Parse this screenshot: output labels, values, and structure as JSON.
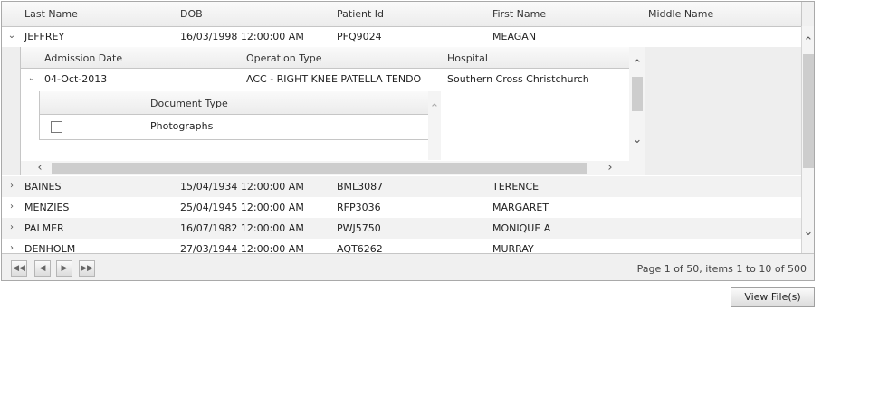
{
  "columns": [
    "Last Name",
    "DOB",
    "Patient Id",
    "First Name",
    "Middle Name"
  ],
  "expanded_row": {
    "last_name": "JEFFREY",
    "dob": "16/03/1998 12:00:00 AM",
    "patient_id": "PFQ9024",
    "first_name": "MEAGAN",
    "middle_name": ""
  },
  "detail": {
    "columns": [
      "Admission Date",
      "Operation Type",
      "Hospital"
    ],
    "row": {
      "admission_date": "04-Oct-2013",
      "operation_type": "ACC - RIGHT KNEE PATELLA TENDO",
      "hospital": "Southern Cross Christchurch"
    },
    "documents": {
      "column": "Document Type",
      "row": {
        "document_type": "Photographs",
        "checked": false
      }
    }
  },
  "rows": [
    {
      "last_name": "BAINES",
      "dob": "15/04/1934 12:00:00 AM",
      "patient_id": "BML3087",
      "first_name": "TERENCE",
      "middle_name": ""
    },
    {
      "last_name": "MENZIES",
      "dob": "25/04/1945 12:00:00 AM",
      "patient_id": "RFP3036",
      "first_name": "MARGARET",
      "middle_name": ""
    },
    {
      "last_name": "PALMER",
      "dob": "16/07/1982 12:00:00 AM",
      "patient_id": "PWJ5750",
      "first_name": "MONIQUE A",
      "middle_name": ""
    },
    {
      "last_name": "DENHOLM",
      "dob": "27/03/1944 12:00:00 AM",
      "patient_id": "AQT6262",
      "first_name": "MURRAY",
      "middle_name": ""
    }
  ],
  "pager": {
    "info": "Page 1 of 50, items 1 to 10 of 500",
    "first_icon": "first-page-icon",
    "prev_icon": "previous-page-icon",
    "next_icon": "next-page-icon",
    "last_icon": "last-page-icon"
  },
  "view_button": "View File(s)",
  "colors": {
    "header_bg": "#ececec",
    "alt_row": "#f2f2f2",
    "border": "#a9a9a9",
    "scroll_thumb": "#cdcdcd"
  }
}
